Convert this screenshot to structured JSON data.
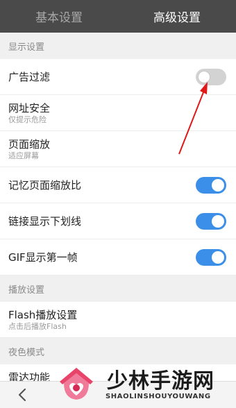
{
  "tabs": [
    {
      "label": "基本设置",
      "active": false
    },
    {
      "label": "高级设置",
      "active": true
    }
  ],
  "sections": {
    "display": "显示设置",
    "playback": "播放设置",
    "night": "夜色模式"
  },
  "settings": {
    "ad_filter": {
      "label": "广告过滤",
      "enabled": false
    },
    "url_security": {
      "label": "网址安全",
      "sub": "仅提示危险"
    },
    "page_zoom": {
      "label": "页面缩放",
      "sub": "适应屏幕"
    },
    "remember_zoom": {
      "label": "记忆页面缩放比",
      "enabled": true
    },
    "link_underline": {
      "label": "链接显示下划线",
      "enabled": true
    },
    "gif_first_frame": {
      "label": "GIF显示第一帧",
      "enabled": true
    },
    "flash": {
      "label": "Flash播放设置",
      "sub": "点击后播放Flash"
    },
    "radar": {
      "label": "雷达功能"
    }
  },
  "colors": {
    "tabbar": "#4a4a4a",
    "toggle_on": "#3b8fe8",
    "toggle_off": "#d3d3d3",
    "annotation_arrow": "#e01818"
  },
  "icons": {
    "back": "chevron-left-icon",
    "logo": "house-heart-logo-icon"
  },
  "watermark": {
    "title": "少林手游网",
    "subtitle": "SHAOLINSHOUYOUWANG"
  }
}
